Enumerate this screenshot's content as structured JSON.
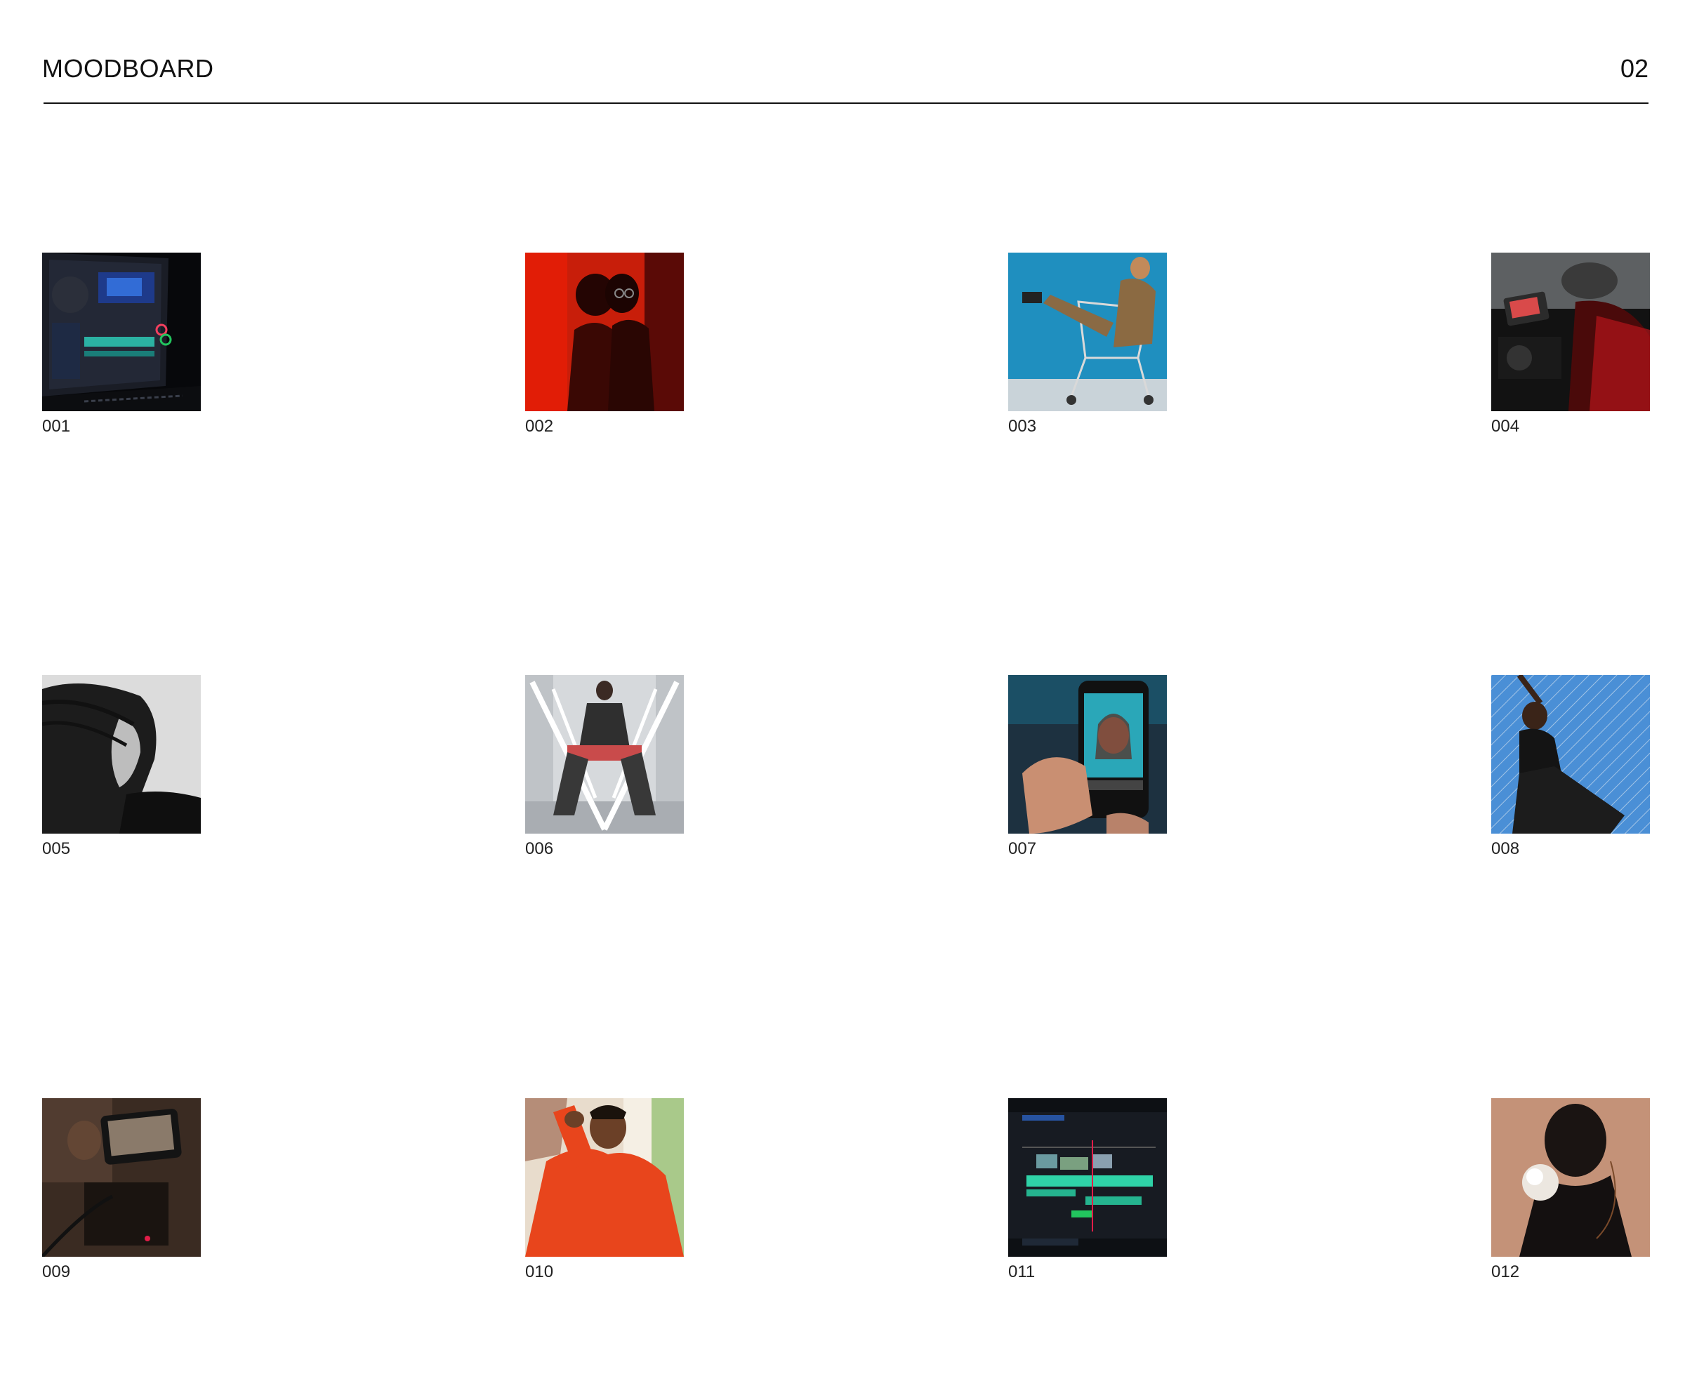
{
  "header": {
    "title": "MOODBOARD",
    "page_number": "02"
  },
  "tiles": [
    {
      "label": "001",
      "scene": "video-editing-laptop-thumbnail"
    },
    {
      "label": "002",
      "scene": "red-lit-portrait-thumbnail"
    },
    {
      "label": "003",
      "scene": "shopping-cart-portrait-thumbnail"
    },
    {
      "label": "004",
      "scene": "camera-operator-red-light-thumbnail"
    },
    {
      "label": "005",
      "scene": "windblown-hair-bw-portrait-thumbnail"
    },
    {
      "label": "006",
      "scene": "neon-v-seated-portrait-thumbnail"
    },
    {
      "label": "007",
      "scene": "phone-photo-editing-thumbnail"
    },
    {
      "label": "008",
      "scene": "fence-sky-portrait-thumbnail"
    },
    {
      "label": "009",
      "scene": "camera-monitor-rig-thumbnail"
    },
    {
      "label": "010",
      "scene": "orange-shirt-portrait-thumbnail"
    },
    {
      "label": "011",
      "scene": "editing-timeline-screen-thumbnail"
    },
    {
      "label": "012",
      "scene": "flower-portrait-thumbnail"
    }
  ]
}
